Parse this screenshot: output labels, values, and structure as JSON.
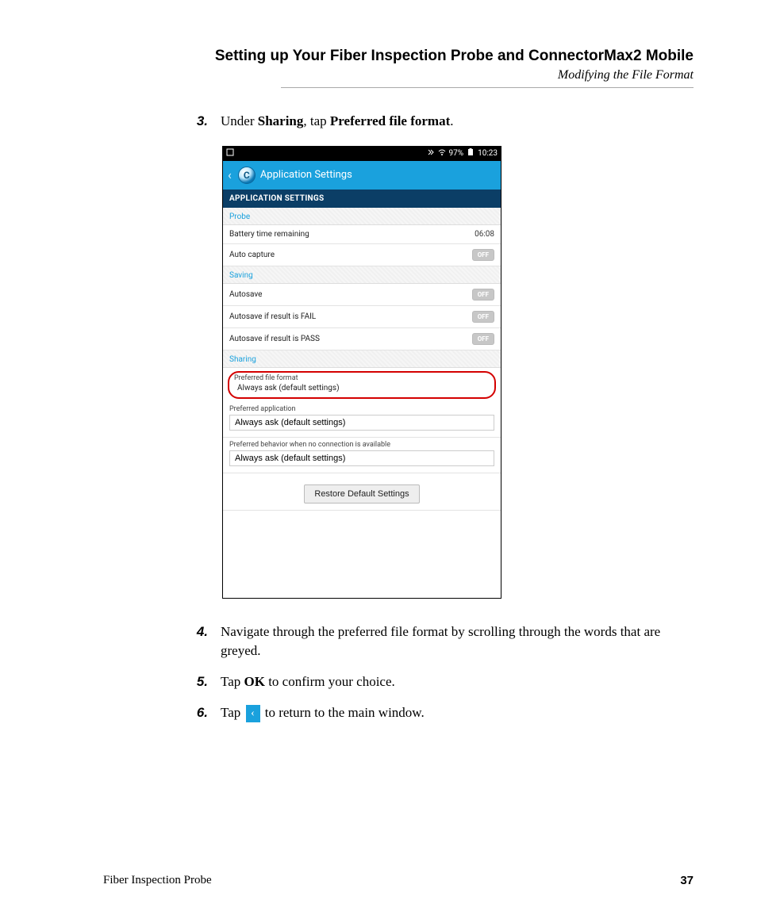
{
  "header": {
    "chapter_title": "Setting up Your Fiber Inspection Probe and ConnectorMax2 Mobile",
    "subtitle": "Modifying the File Format"
  },
  "steps": {
    "s3": {
      "num": "3.",
      "pre": "Under ",
      "b1": "Sharing",
      "mid": ", tap ",
      "b2": "Preferred file format",
      "post": "."
    },
    "s4": {
      "num": "4.",
      "text": "Navigate through the preferred file format by scrolling through the words that are greyed."
    },
    "s5": {
      "num": "5.",
      "pre": "Tap ",
      "b1": "OK",
      "post": " to confirm your choice."
    },
    "s6": {
      "num": "6.",
      "pre": "Tap ",
      "post": " to return to the main window."
    }
  },
  "phone": {
    "status": {
      "battery_pct": "97%",
      "time": "10:23"
    },
    "titlebar": {
      "badge_letter": "C",
      "title": "Application Settings"
    },
    "darkbar": "APPLICATION SETTINGS",
    "sections": {
      "probe": {
        "header": "Probe",
        "battery_label": "Battery time remaining",
        "battery_value": "06:08",
        "autocapture_label": "Auto capture",
        "autocapture_toggle": "OFF"
      },
      "saving": {
        "header": "Saving",
        "autosave_label": "Autosave",
        "autosave_toggle": "OFF",
        "autosave_fail_label": "Autosave if result is FAIL",
        "autosave_fail_toggle": "OFF",
        "autosave_pass_label": "Autosave if result is PASS",
        "autosave_pass_toggle": "OFF"
      },
      "sharing": {
        "header": "Sharing",
        "pref_file_label": "Preferred file format",
        "pref_file_value": "Always ask (default settings)",
        "pref_app_label": "Preferred application",
        "pref_app_value": "Always ask (default settings)",
        "pref_conn_label": "Preferred behavior when no connection is available",
        "pref_conn_value": "Always ask (default settings)"
      }
    },
    "restore_btn": "Restore Default Settings"
  },
  "footer": {
    "product": "Fiber Inspection Probe",
    "page": "37"
  }
}
